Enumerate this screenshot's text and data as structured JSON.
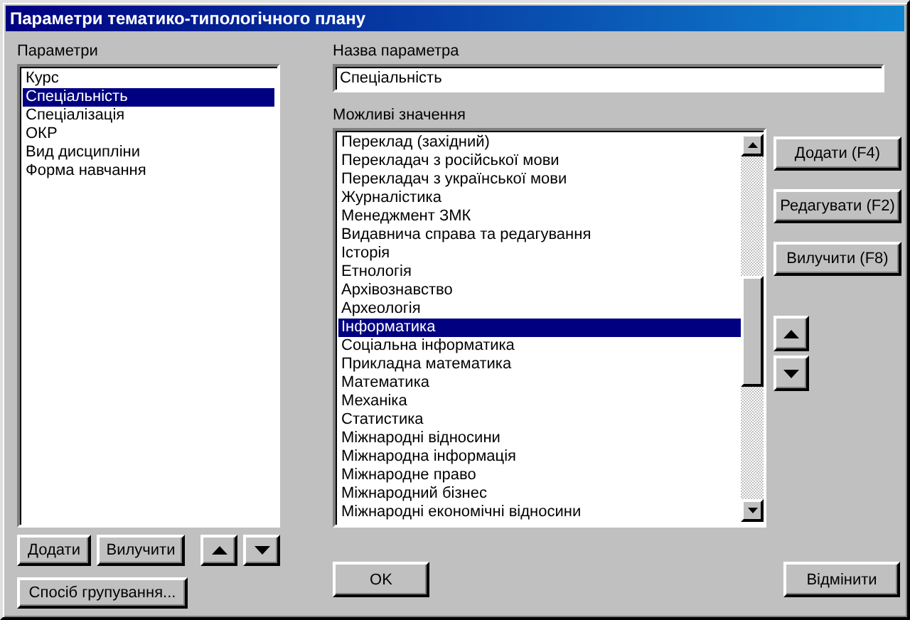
{
  "window": {
    "title": "Параметри тематико-типологічного плану"
  },
  "parameters": {
    "label": "Параметри",
    "items": [
      {
        "text": "Курс",
        "selected": false
      },
      {
        "text": "Спеціальність",
        "selected": true
      },
      {
        "text": "Спеціалізація",
        "selected": false
      },
      {
        "text": "ОКР",
        "selected": false
      },
      {
        "text": "Вид дисципліни",
        "selected": false
      },
      {
        "text": "Форма навчання",
        "selected": false
      }
    ],
    "buttons": [
      {
        "kind": "text",
        "label": "Додати"
      },
      {
        "kind": "text",
        "label": "Вилучити"
      },
      {
        "kind": "up"
      },
      {
        "kind": "down"
      }
    ],
    "grouping_button": "Спосіб групування..."
  },
  "parameter_name": {
    "label": "Назва параметра",
    "value": "Спеціальність"
  },
  "values": {
    "label": "Можливі значення",
    "items": [
      {
        "text": "Переклад (західний)",
        "selected": false
      },
      {
        "text": "Перекладач з російської мови",
        "selected": false
      },
      {
        "text": "Перекладач з української мови",
        "selected": false
      },
      {
        "text": "Журналістика",
        "selected": false
      },
      {
        "text": "Менеджмент ЗМК",
        "selected": false
      },
      {
        "text": "Видавнича справа та редагування",
        "selected": false
      },
      {
        "text": "Історія",
        "selected": false
      },
      {
        "text": "Етнологія",
        "selected": false
      },
      {
        "text": "Архівознавство",
        "selected": false
      },
      {
        "text": "Археологія",
        "selected": false
      },
      {
        "text": "Інформатика",
        "selected": true
      },
      {
        "text": "Соціальна інформатика",
        "selected": false
      },
      {
        "text": "Прикладна математика",
        "selected": false
      },
      {
        "text": "Математика",
        "selected": false
      },
      {
        "text": "Механіка",
        "selected": false
      },
      {
        "text": "Статистика",
        "selected": false
      },
      {
        "text": "Міжнародні відносини",
        "selected": false
      },
      {
        "text": "Міжнародна інформація",
        "selected": false
      },
      {
        "text": "Міжнародне право",
        "selected": false
      },
      {
        "text": "Міжнародний бізнес",
        "selected": false
      },
      {
        "text": "Міжнародні економічні відносини",
        "selected": false
      }
    ],
    "buttons": [
      {
        "kind": "text",
        "label": "Додати (F4)"
      },
      {
        "kind": "text",
        "label": "Редагувати (F2)"
      },
      {
        "kind": "text",
        "label": "Вилучити (F8)"
      },
      {
        "kind": "up"
      },
      {
        "kind": "down"
      }
    ]
  },
  "ok_button": "OK",
  "cancel_button": "Відмінити"
}
